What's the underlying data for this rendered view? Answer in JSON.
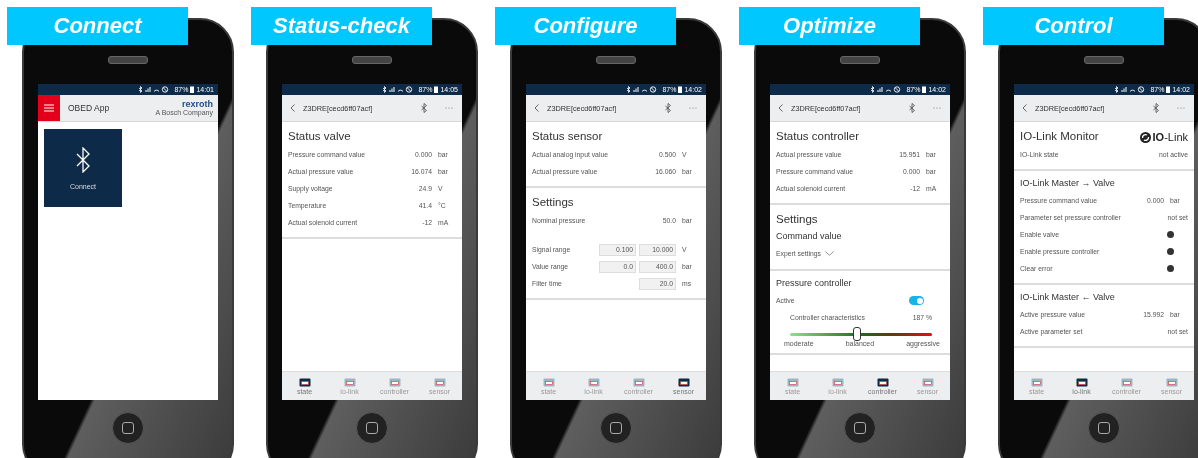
{
  "panels": [
    {
      "banner": "Connect",
      "status": {
        "battery": "87%",
        "time": "14:01"
      },
      "header": {
        "kind": "home",
        "title": "OBED App",
        "brand": "rexroth",
        "brand_sub": "A Bosch Company"
      },
      "tiles": [
        {
          "label": "Connect"
        }
      ]
    },
    {
      "banner": "Status-check",
      "status": {
        "battery": "87%",
        "time": "14:05"
      },
      "header": {
        "kind": "device",
        "title": "Z3DRE[cecd6ff07acf]"
      },
      "sections": [
        {
          "title": "Status valve",
          "rows": [
            {
              "kind": "value",
              "label": "Pressure command value",
              "value": "0.000",
              "unit": "bar"
            },
            {
              "kind": "value",
              "label": "Actual pressure value",
              "value": "16.074",
              "unit": "bar"
            },
            {
              "kind": "value",
              "label": "Supply voltage",
              "value": "24.9",
              "unit": "V"
            },
            {
              "kind": "value",
              "label": "Temperature",
              "value": "41.4",
              "unit": "°C"
            },
            {
              "kind": "value",
              "label": "Actual solenoid current",
              "value": "-12",
              "unit": "mA"
            }
          ]
        }
      ],
      "nav": [
        {
          "label": "state",
          "selected": true
        },
        {
          "label": "io-link",
          "selected": false
        },
        {
          "label": "controller",
          "selected": false
        },
        {
          "label": "sensor",
          "selected": false
        }
      ]
    },
    {
      "banner": "Configure",
      "status": {
        "battery": "87%",
        "time": "14:02"
      },
      "header": {
        "kind": "device",
        "title": "Z3DRE[cecd6ff07acf]"
      },
      "sections": [
        {
          "title": "Status sensor",
          "rows": [
            {
              "kind": "value",
              "label": "Actual analog input value",
              "value": "0.500",
              "unit": "V"
            },
            {
              "kind": "value",
              "label": "Actual pressure value",
              "value": "16.060",
              "unit": "bar"
            }
          ]
        },
        {
          "title": "Settings",
          "rows": [
            {
              "kind": "value",
              "label": "Nominal pressure",
              "value": "50.0",
              "unit": "bar"
            },
            {
              "kind": "inputs",
              "label": "Signal range",
              "fields": [
                "0.100",
                "10.000"
              ],
              "unit": "V"
            },
            {
              "kind": "inputs",
              "label": "Value range",
              "fields": [
                "0.0",
                "400.0"
              ],
              "unit": "bar"
            },
            {
              "kind": "inputs",
              "label": "Filter time",
              "fields": [
                "20.0"
              ],
              "unit": "ms"
            }
          ]
        }
      ],
      "nav": [
        {
          "label": "state",
          "selected": false
        },
        {
          "label": "io-link",
          "selected": false
        },
        {
          "label": "controller",
          "selected": false
        },
        {
          "label": "sensor",
          "selected": true
        }
      ]
    },
    {
      "banner": "Optimize",
      "status": {
        "battery": "87%",
        "time": "14:02"
      },
      "header": {
        "kind": "device",
        "title": "Z3DRE[cecd6ff07acf]"
      },
      "sections": [
        {
          "title": "Status controller",
          "rows": [
            {
              "kind": "value",
              "label": "Actual pressure value",
              "value": "15.951",
              "unit": "bar"
            },
            {
              "kind": "value",
              "label": "Pressure command value",
              "value": "0.000",
              "unit": "bar"
            },
            {
              "kind": "value",
              "label": "Actual solenoid current",
              "value": "-12",
              "unit": "mA"
            }
          ]
        },
        {
          "title": "Settings",
          "rows": [
            {
              "kind": "subheading",
              "label": "Command value"
            },
            {
              "kind": "link",
              "label": "Expert settings"
            }
          ]
        },
        {
          "title": "Pressure controller",
          "small": true,
          "rows": [
            {
              "kind": "toggle",
              "label": "Active",
              "on": true
            },
            {
              "kind": "slider",
              "label": "Controller characteristics",
              "reading": "187 %",
              "level": 0.47,
              "marks": [
                "moderate",
                "balanced",
                "aggressive"
              ]
            }
          ]
        }
      ],
      "nav": [
        {
          "label": "state",
          "selected": false
        },
        {
          "label": "io-link",
          "selected": false
        },
        {
          "label": "controller",
          "selected": true
        },
        {
          "label": "sensor",
          "selected": false
        }
      ]
    },
    {
      "banner": "Control",
      "status": {
        "battery": "87%",
        "time": "14:02"
      },
      "header": {
        "kind": "device",
        "title": "Z3DRE[cecd6ff07acf]"
      },
      "sections": [
        {
          "title": "IO-Link Monitor",
          "logo": "**IO**-Link",
          "rows": [
            {
              "kind": "value",
              "label": "IO-Link state",
              "value": "not active"
            }
          ]
        },
        {
          "title": "IO-Link Master → Valve",
          "small": true,
          "rows": [
            {
              "kind": "value",
              "label": "Pressure command value",
              "value": "0.000",
              "unit": "bar"
            },
            {
              "kind": "value",
              "label": "Parameter set pressure controller",
              "value": "not set"
            },
            {
              "kind": "indicator",
              "label": "Enable valve"
            },
            {
              "kind": "indicator",
              "label": "Enable pressure controller"
            },
            {
              "kind": "indicator",
              "label": "Clear error"
            }
          ]
        },
        {
          "title": "IO-Link Master ← Valve",
          "small": true,
          "rows": [
            {
              "kind": "value",
              "label": "Active pressure value",
              "value": "15.992",
              "unit": "bar"
            },
            {
              "kind": "value",
              "label": "Active parameter set",
              "value": "not set"
            }
          ]
        }
      ],
      "nav": [
        {
          "label": "state",
          "selected": false
        },
        {
          "label": "io-link",
          "selected": true
        },
        {
          "label": "controller",
          "selected": false
        },
        {
          "label": "sensor",
          "selected": false
        }
      ]
    }
  ]
}
